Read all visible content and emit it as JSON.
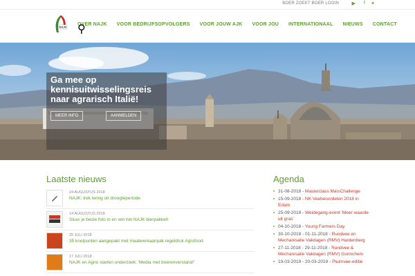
{
  "topbar": {
    "login_link": "BOER ZOEKT BOER LOGIN",
    "social_icons": [
      "youtube-icon",
      "facebook-icon",
      "twitter-icon"
    ]
  },
  "header": {
    "logo_text": "NAJK",
    "nav": [
      {
        "label": "OVER NAJK"
      },
      {
        "label": "VOOR BEDRIJFSOPVOLGERS"
      },
      {
        "label": "VOOR JOUW AJK"
      },
      {
        "label": "VOOR JOU"
      },
      {
        "label": "INTERNATIONAAL"
      },
      {
        "label": "NIEUWS"
      },
      {
        "label": "CONTACT"
      }
    ],
    "search_icon": "search-icon"
  },
  "hero": {
    "title": "Ga mee op kennisuitwisselingsreis naar agrarisch Italië!",
    "button_1": "MEER INFO",
    "button_2": "AANMELDEN"
  },
  "news": {
    "title": "Laatste nieuws",
    "items": [
      {
        "date": "24 AUGUSTUS 2018",
        "title": "NAJK: trek lering uit droogteperiode"
      },
      {
        "date": "14 AUGUSTUS 2018",
        "title": "Stuur je beste foto in en win het NAJK-bierpakket!"
      },
      {
        "date": "25 JULI 2018",
        "title": "35 knelpunten aangepakt met maatwerkaanpak regeldruk Agrofood"
      },
      {
        "date": "17 JULI 2018",
        "title": "NAJK en Agrio starten onderzoek: 'Media met boerenverstand!'"
      }
    ]
  },
  "agenda": {
    "title": "Agenda",
    "items": [
      {
        "date": "31-08-2018",
        "event": "Masterclass MaïsChallenge"
      },
      {
        "date": "15-09-2018",
        "event": "NK Veebeoordelen 2018 in Edam"
      },
      {
        "date": "25-09-2018",
        "event": "Weidegang-event 'Meer waarde uit gras'"
      },
      {
        "date": "04-10-2018",
        "event": "Young Farmers Day"
      },
      {
        "date": "30-10-2018 - 01-11-2018",
        "event": "Rundvee en Mechanisatie Vakdagen (RMV) Hardenberg"
      },
      {
        "date": "27-11-2018 - 29-11-2018",
        "event": "Rundvee & Mechanisatie Vakdagen (RMV) Gorinchem"
      },
      {
        "date": "19-03-2019 - 20-03-2019",
        "event": "Pluimvee-editie"
      }
    ]
  },
  "colors": {
    "accent": "#5c9e2e",
    "agenda_link": "#c43a2a"
  }
}
